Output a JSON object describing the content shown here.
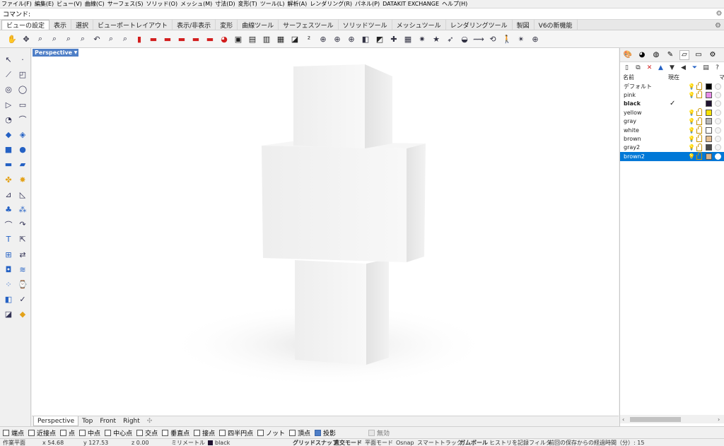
{
  "menu": [
    "ファイル(F)",
    "編集(E)",
    "ビュー(V)",
    "曲線(C)",
    "サーフェス(S)",
    "ソリッド(O)",
    "メッシュ(M)",
    "寸法(D)",
    "変形(T)",
    "ツール(L)",
    "解析(A)",
    "レンダリング(R)",
    "パネル(P)",
    "DATAKIT EXCHANGE",
    "ヘルプ(H)"
  ],
  "command": {
    "label": "コマンド:",
    "value": ""
  },
  "toolbar_tabs": [
    {
      "label": "ビューの設定",
      "active": true
    },
    {
      "label": "表示"
    },
    {
      "label": "選択"
    },
    {
      "label": "ビューポートレイアウト"
    },
    {
      "label": "表示/非表示"
    },
    {
      "label": "変形"
    },
    {
      "label": "曲線ツール"
    },
    {
      "label": "サーフェスツール"
    },
    {
      "label": "ソリッドツール"
    },
    {
      "label": "メッシュツール"
    },
    {
      "label": "レンダリングツール"
    },
    {
      "label": "製図"
    },
    {
      "label": "V6の新機能"
    }
  ],
  "viewport": {
    "title": "Perspective"
  },
  "view_tabs": [
    {
      "label": "Perspective",
      "active": true
    },
    {
      "label": "Top"
    },
    {
      "label": "Front"
    },
    {
      "label": "Right"
    },
    {
      "label": "✣"
    }
  ],
  "layers_panel": {
    "col_name": "名前",
    "col_current": "現在",
    "col_mat": "マ",
    "layers": [
      {
        "name": "デフォルト",
        "color": "#000000"
      },
      {
        "name": "pink",
        "color": "#e88ce8"
      },
      {
        "name": "black",
        "color": "#1f1230",
        "current": true
      },
      {
        "name": "yellow",
        "color": "#f7e200"
      },
      {
        "name": "gray",
        "color": "#b5b5b5"
      },
      {
        "name": "white",
        "color": "#ffffff"
      },
      {
        "name": "brown",
        "color": "#e6bf91"
      },
      {
        "name": "gray2",
        "color": "#4a4a4a"
      },
      {
        "name": "brown2",
        "color": "#d9b48a",
        "selected": true
      }
    ]
  },
  "osnap": [
    {
      "label": "端点"
    },
    {
      "label": "近接点"
    },
    {
      "label": "点"
    },
    {
      "label": "中点"
    },
    {
      "label": "中心点"
    },
    {
      "label": "交点"
    },
    {
      "label": "垂直点"
    },
    {
      "label": "接点"
    },
    {
      "label": "四半円点"
    },
    {
      "label": "ノット"
    },
    {
      "label": "頂点"
    },
    {
      "label": "投影",
      "checked": true
    },
    {
      "label": "無効",
      "disabled": true
    }
  ],
  "status": {
    "cplane": "作業平面",
    "x": "x 54.68",
    "y": "y 127.53",
    "z": "z 0.00",
    "units": "ミリメートル",
    "layer": "black",
    "grid_snap": "グリッドスナップ",
    "ortho": "直交モード",
    "planar": "平面モード",
    "osnap": "Osnap",
    "smart_track": "スマートトラック",
    "gumball": "ガムボール",
    "record_history": "ヒストリを記録",
    "filter": "フィルタ",
    "elapsed": "前回の保存からの経過時間（分）: 15"
  }
}
